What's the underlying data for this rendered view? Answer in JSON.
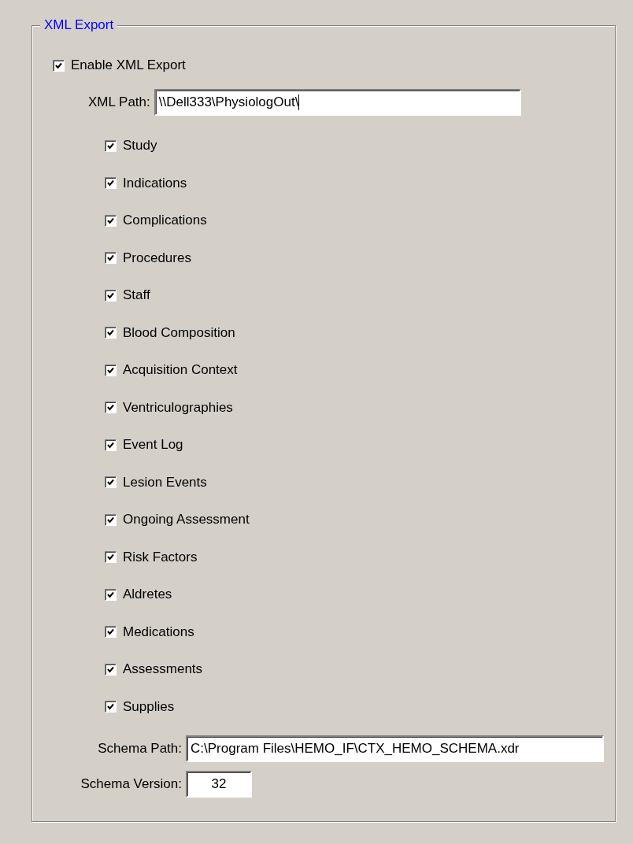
{
  "group": {
    "title": "XML Export"
  },
  "enable": {
    "label": "Enable XML Export",
    "checked": true
  },
  "xml_path": {
    "label": "XML Path:",
    "value": "\\\\Dell333\\PhysiologOut\\"
  },
  "sections": [
    {
      "label": "Study",
      "checked": true
    },
    {
      "label": "Indications",
      "checked": true
    },
    {
      "label": "Complications",
      "checked": true
    },
    {
      "label": "Procedures",
      "checked": true
    },
    {
      "label": "Staff",
      "checked": true
    },
    {
      "label": "Blood Composition",
      "checked": true
    },
    {
      "label": "Acquisition Context",
      "checked": true
    },
    {
      "label": "Ventriculographies",
      "checked": true
    },
    {
      "label": "Event Log",
      "checked": true
    },
    {
      "label": "Lesion Events",
      "checked": true
    },
    {
      "label": "Ongoing Assessment",
      "checked": true
    },
    {
      "label": "Risk Factors",
      "checked": true
    },
    {
      "label": "Aldretes",
      "checked": true
    },
    {
      "label": "Medications",
      "checked": true
    },
    {
      "label": "Assessments",
      "checked": true
    },
    {
      "label": "Supplies",
      "checked": true
    }
  ],
  "schema_path": {
    "label": "Schema Path:",
    "value": "C:\\Program Files\\HEMO_IF\\CTX_HEMO_SCHEMA.xdr"
  },
  "schema_version": {
    "label": "Schema Version:",
    "value": "32"
  }
}
